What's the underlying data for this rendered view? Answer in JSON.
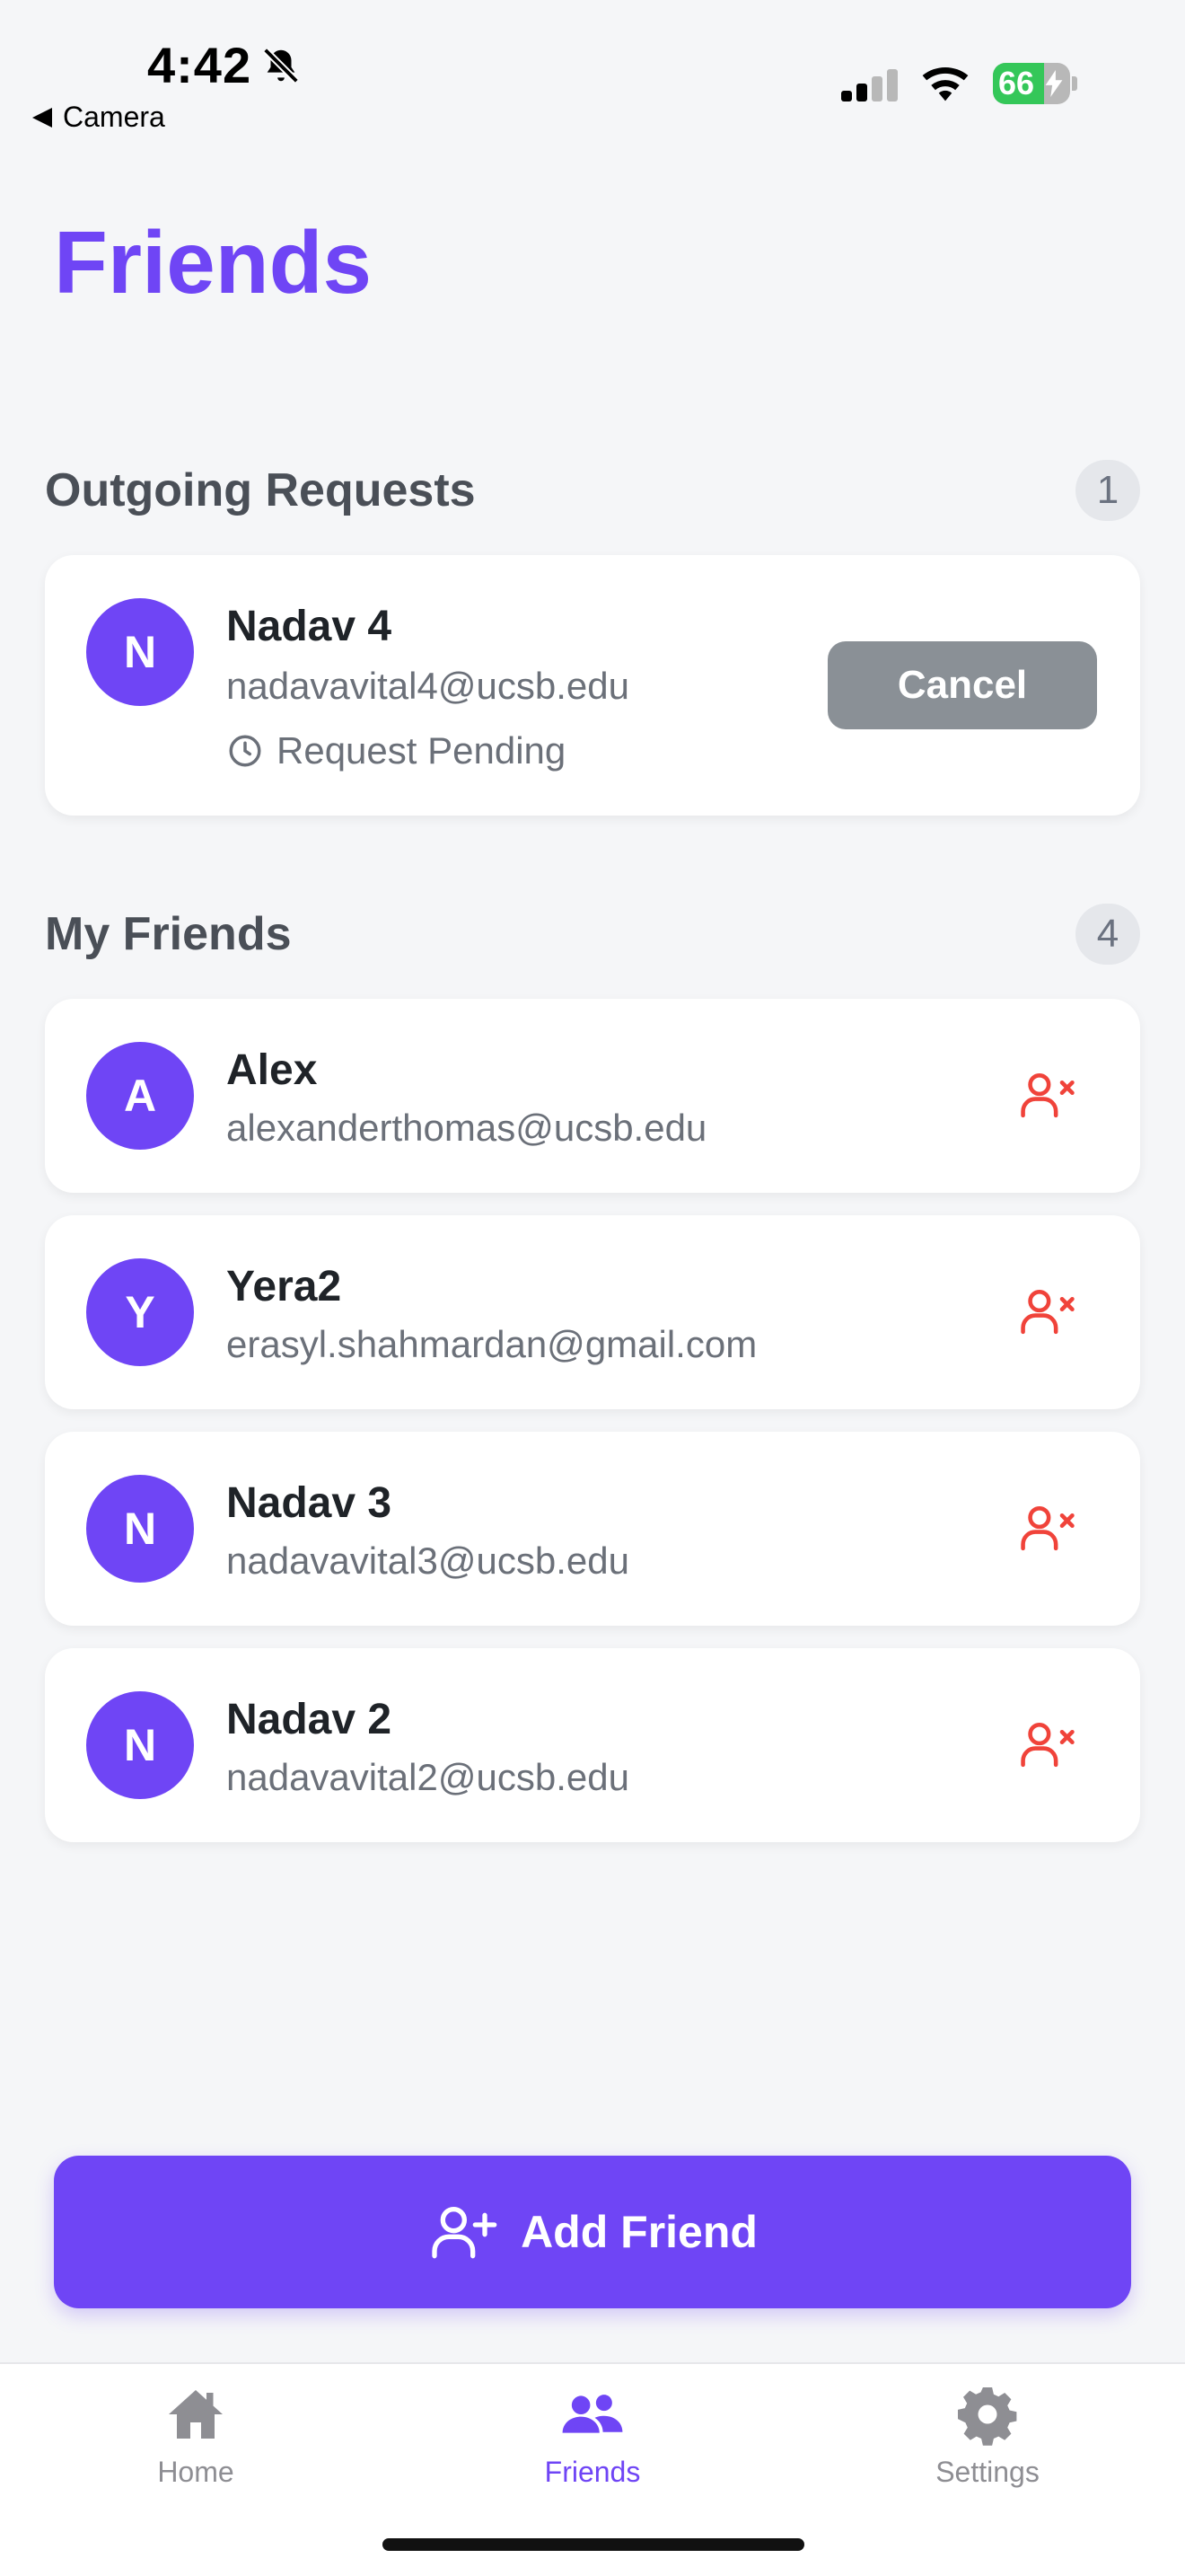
{
  "status_bar": {
    "time": "4:42",
    "back_app": "Camera",
    "battery": "66"
  },
  "page": {
    "title": "Friends"
  },
  "outgoing": {
    "title": "Outgoing Requests",
    "count": "1",
    "requests": [
      {
        "initial": "N",
        "name": "Nadav 4",
        "email": "nadavavital4@ucsb.edu",
        "status": "Request Pending",
        "action": "Cancel"
      }
    ]
  },
  "friends": {
    "title": "My Friends",
    "count": "4",
    "items": [
      {
        "initial": "A",
        "name": "Alex",
        "email": "alexanderthomas@ucsb.edu"
      },
      {
        "initial": "Y",
        "name": "Yera2",
        "email": "erasyl.shahmardan@gmail.com"
      },
      {
        "initial": "N",
        "name": "Nadav 3",
        "email": "nadavavital3@ucsb.edu"
      },
      {
        "initial": "N",
        "name": "Nadav 2",
        "email": "nadavavital2@ucsb.edu"
      }
    ]
  },
  "add_friend": {
    "label": "Add Friend"
  },
  "tabs": [
    {
      "label": "Home",
      "icon": "home-icon"
    },
    {
      "label": "Friends",
      "icon": "friends-icon",
      "active": true
    },
    {
      "label": "Settings",
      "icon": "gear-icon"
    }
  ],
  "colors": {
    "accent": "#6F45F5",
    "danger": "#F0433A",
    "cancel": "#8A9096",
    "battery": "#34C759"
  }
}
